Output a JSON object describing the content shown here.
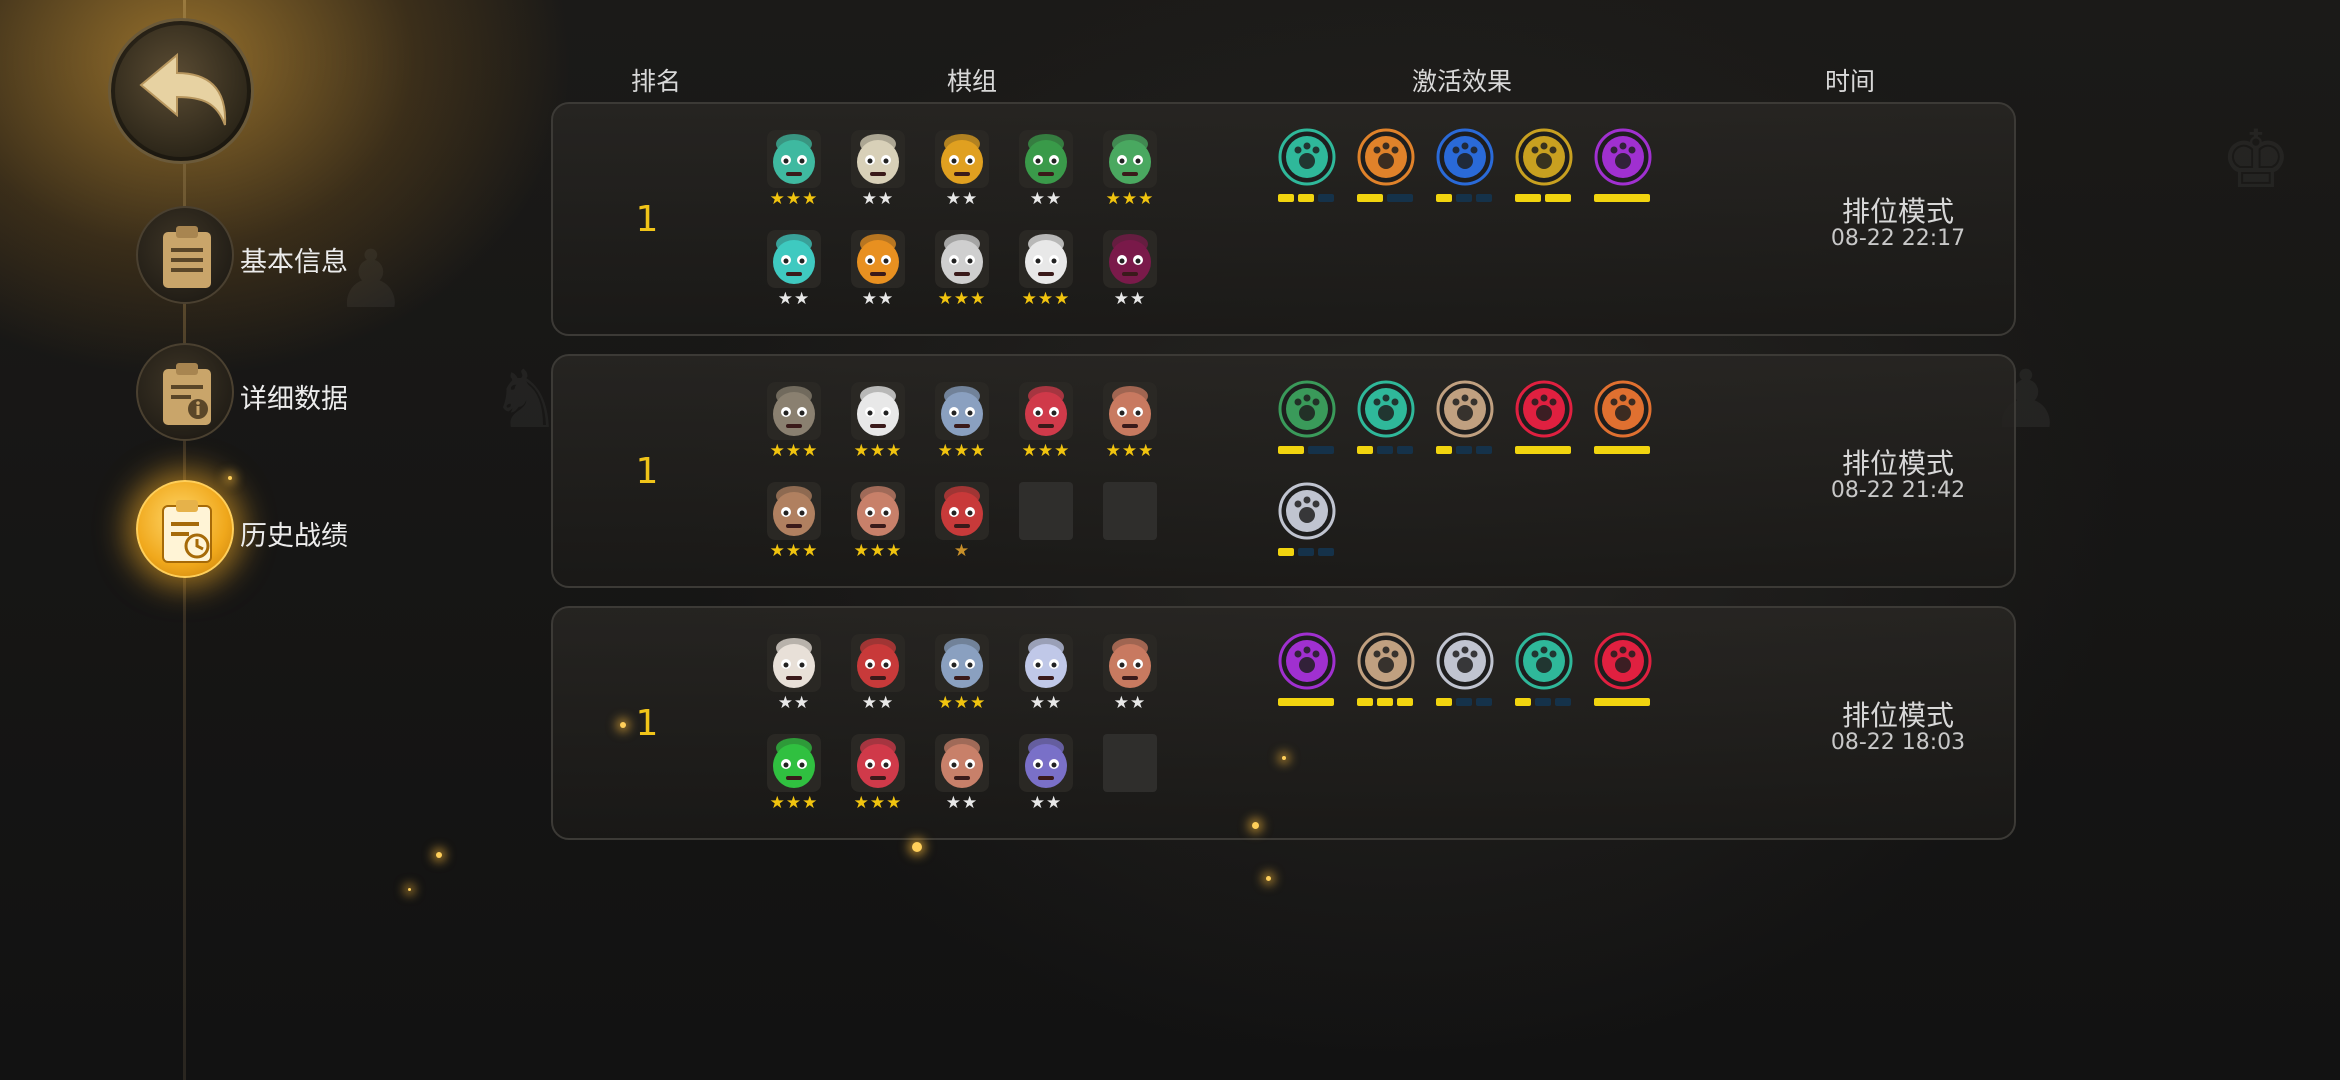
{
  "colors": {
    "accent_gold": "#f0c419",
    "star_gold": "#f1c40f",
    "star_silver": "#e8e8e8",
    "star_bronze": "#c8902a",
    "bar_active": "#f1d40f",
    "bar_inactive": "#15324a"
  },
  "nav": {
    "back_icon": "back-arrow-icon",
    "items": [
      {
        "label": "基本信息",
        "icon": "clipboard-icon",
        "active": false
      },
      {
        "label": "详细数据",
        "icon": "clipboard-info-icon",
        "active": false
      },
      {
        "label": "历史战绩",
        "icon": "clipboard-clock-icon",
        "active": true
      }
    ]
  },
  "headers": {
    "rank": "排名",
    "lineup": "棋组",
    "synergy": "激活效果",
    "time": "时间"
  },
  "matches": [
    {
      "rank": "1",
      "mode": "排位模式",
      "time": "08-22 22:17",
      "pieces": [
        {
          "stars": 3,
          "color": "#3fb9a0",
          "icon": "teal-warrior-portrait"
        },
        {
          "stars": 2,
          "color": "#d8d0b8",
          "icon": "white-hat-portrait"
        },
        {
          "stars": 2,
          "color": "#e0a020",
          "icon": "hooded-gold-portrait"
        },
        {
          "stars": 2,
          "color": "#3a9a4a",
          "icon": "green-mask-portrait"
        },
        {
          "stars": 3,
          "color": "#4aa860",
          "icon": "goblin-glasses-portrait"
        },
        {
          "stars": 2,
          "color": "#3fc9c0",
          "icon": "robot-portrait"
        },
        {
          "stars": 2,
          "color": "#e89020",
          "icon": "orange-beast-portrait"
        },
        {
          "stars": 3,
          "color": "#cfcfcf",
          "icon": "white-beast-portrait"
        },
        {
          "stars": 3,
          "color": "#e8e8e8",
          "icon": "yeti-portrait"
        },
        {
          "stars": 2,
          "color": "#7a1a4a",
          "icon": "demon-portrait"
        }
      ],
      "synergies": [
        {
          "icon": "paw-icon",
          "color": "#2fb89a",
          "on": 2,
          "total": 3
        },
        {
          "icon": "leaf-icon",
          "color": "#e0822a",
          "on": 1,
          "total": 2
        },
        {
          "icon": "feather-icon",
          "color": "#2a6ad8",
          "on": 1,
          "total": 3
        },
        {
          "icon": "daggers-icon",
          "color": "#c8a020",
          "on": 2,
          "total": 2
        },
        {
          "icon": "demon-skull-icon",
          "color": "#a030d0",
          "on": 1,
          "total": 1
        }
      ]
    },
    {
      "rank": "1",
      "mode": "排位模式",
      "time": "08-22 21:42",
      "pieces": [
        {
          "stars": 3,
          "color": "#8a8070",
          "icon": "helmet-dwarf-portrait"
        },
        {
          "stars": 3,
          "color": "#e8e8e8",
          "icon": "white-horned-portrait"
        },
        {
          "stars": 3,
          "color": "#8aa0c0",
          "icon": "silver-knight-portrait"
        },
        {
          "stars": 3,
          "color": "#d03a4a",
          "icon": "red-ogre-portrait"
        },
        {
          "stars": 3,
          "color": "#c87a60",
          "icon": "bearded-horned-portrait"
        },
        {
          "stars": 3,
          "color": "#b08060",
          "icon": "gunner-portrait"
        },
        {
          "stars": 3,
          "color": "#c8806a",
          "icon": "pig-portrait"
        },
        {
          "stars": 1,
          "color": "#c83a3a",
          "icon": "red-hat-portrait"
        },
        {
          "stars": 0,
          "color": "",
          "icon": "empty-slot"
        },
        {
          "stars": 0,
          "color": "",
          "icon": "empty-slot"
        }
      ],
      "synergies": [
        {
          "icon": "crossbow-icon",
          "color": "#3a9a5a",
          "on": 1,
          "total": 2
        },
        {
          "icon": "paw-icon",
          "color": "#2fb89a",
          "on": 1,
          "total": 3
        },
        {
          "icon": "axe-icon",
          "color": "#c0a080",
          "on": 1,
          "total": 3
        },
        {
          "icon": "rainbow-arch-icon",
          "color": "#e02040",
          "on": 1,
          "total": 1
        },
        {
          "icon": "viking-helmet-icon",
          "color": "#e07030",
          "on": 1,
          "total": 1
        },
        {
          "icon": "bust-icon",
          "color": "#c0c4d0",
          "on": 1,
          "total": 3
        }
      ]
    },
    {
      "rank": "1",
      "mode": "排位模式",
      "time": "08-22 18:03",
      "pieces": [
        {
          "stars": 2,
          "color": "#e8e0d8",
          "icon": "skull-mask-portrait"
        },
        {
          "stars": 2,
          "color": "#c83a3a",
          "icon": "red-hat-portrait"
        },
        {
          "stars": 3,
          "color": "#8aa0c0",
          "icon": "silver-knight-portrait"
        },
        {
          "stars": 2,
          "color": "#c0c8e8",
          "icon": "glasses-mage-portrait"
        },
        {
          "stars": 2,
          "color": "#c87a60",
          "icon": "bearded-horned-portrait"
        },
        {
          "stars": 3,
          "color": "#30c040",
          "icon": "green-orb-portrait"
        },
        {
          "stars": 3,
          "color": "#d03a4a",
          "icon": "red-ogre-portrait"
        },
        {
          "stars": 2,
          "color": "#c8806a",
          "icon": "pig-portrait"
        },
        {
          "stars": 2,
          "color": "#7a70c8",
          "icon": "purple-beast-portrait"
        },
        {
          "stars": 0,
          "color": "",
          "icon": "empty-slot"
        }
      ],
      "synergies": [
        {
          "icon": "demon-skull-icon",
          "color": "#a030d0",
          "on": 1,
          "total": 1
        },
        {
          "icon": "axe-icon",
          "color": "#c0a080",
          "on": 3,
          "total": 3
        },
        {
          "icon": "bust-icon",
          "color": "#c0c4d0",
          "on": 1,
          "total": 3
        },
        {
          "icon": "paw-icon",
          "color": "#2fb89a",
          "on": 1,
          "total": 3
        },
        {
          "icon": "rainbow-arch-icon",
          "color": "#e02040",
          "on": 1,
          "total": 1
        }
      ]
    }
  ]
}
